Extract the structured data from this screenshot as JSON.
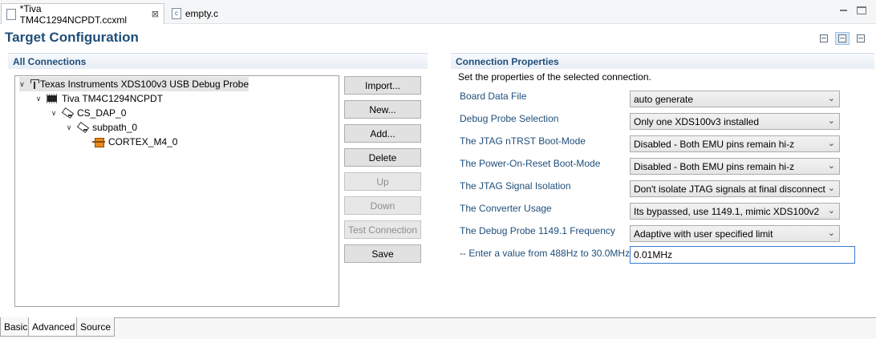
{
  "tabs": {
    "active": {
      "label": "*Tiva TM4C1294NCPDT.ccxml",
      "close": "⊠"
    },
    "second": {
      "label": "empty.c"
    }
  },
  "title": "Target Configuration",
  "connections": {
    "header": "All Connections",
    "tree": [
      {
        "label": "Texas Instruments XDS100v3 USB Debug Probe",
        "icon": "probe-icon"
      },
      {
        "label": "Tiva TM4C1294NCPDT",
        "icon": "chip-icon"
      },
      {
        "label": "CS_DAP_0",
        "icon": "dap-icon"
      },
      {
        "label": "subpath_0",
        "icon": "subpath-icon"
      },
      {
        "label": "CORTEX_M4_0",
        "icon": "cpu-core-icon"
      }
    ],
    "buttons": {
      "import": "Import...",
      "new": "New...",
      "add": "Add...",
      "delete": "Delete",
      "up": "Up",
      "down": "Down",
      "test": "Test Connection",
      "save": "Save"
    }
  },
  "properties": {
    "header": "Connection Properties",
    "description": "Set the properties of the selected connection.",
    "fields": [
      {
        "label": "Board Data File",
        "value": "auto generate"
      },
      {
        "label": "Debug Probe Selection",
        "value": "Only one XDS100v3 installed"
      },
      {
        "label": "The JTAG nTRST Boot-Mode",
        "value": "Disabled - Both EMU pins remain hi-z"
      },
      {
        "label": "The Power-On-Reset Boot-Mode",
        "value": "Disabled - Both EMU pins remain hi-z"
      },
      {
        "label": "The JTAG Signal Isolation",
        "value": "Don't isolate JTAG signals at final disconnect"
      },
      {
        "label": "The Converter Usage",
        "value": "Its bypassed, use 1149.1, mimic XDS100v2"
      },
      {
        "label": "The Debug Probe 1149.1 Frequency",
        "value": "Adaptive with user specified limit"
      }
    ],
    "freq_label": "-- Enter a value from 488Hz to 30.0MHz",
    "freq_value": "0.01MHz"
  },
  "bottom_tabs": [
    "Basic",
    "Advanced",
    "Source"
  ],
  "colors": {
    "title": "#1f4e7a",
    "selection": "#e4e4e4",
    "focus_border": "#3a7bd5"
  }
}
